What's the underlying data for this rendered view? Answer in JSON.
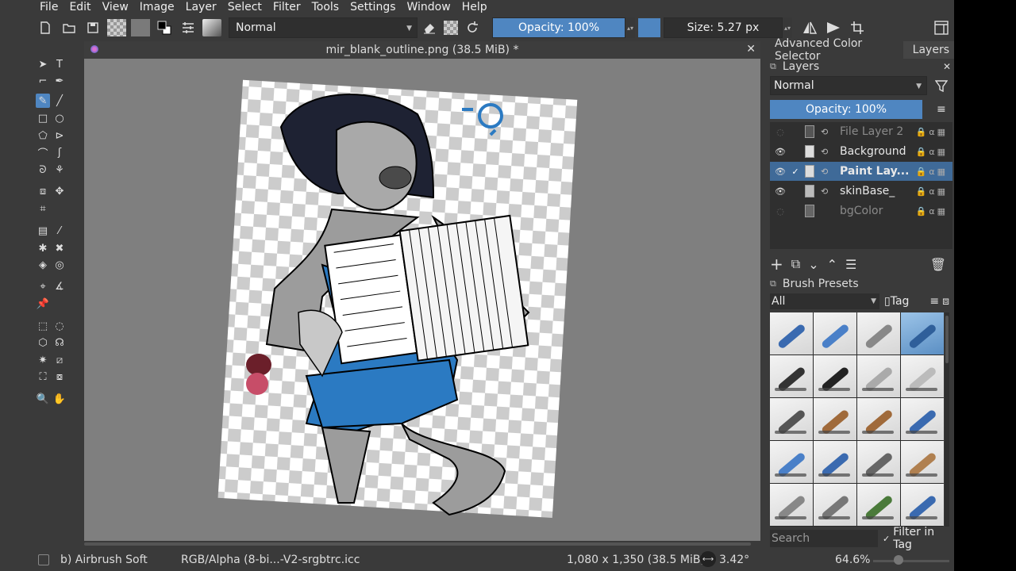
{
  "menu": [
    "File",
    "Edit",
    "View",
    "Image",
    "Layer",
    "Select",
    "Filter",
    "Tools",
    "Settings",
    "Window",
    "Help"
  ],
  "toolbar": {
    "blend_mode": "Normal",
    "opacity_label": "Opacity: 100%",
    "size_label": "Size: 5.27 px",
    "brush_color": "#4f86c1"
  },
  "document": {
    "title": "mir_blank_outline.png (38.5 MiB) *"
  },
  "docker": {
    "tabs": [
      "Advanced Color Selector",
      "Layers"
    ],
    "layers_title": "Layers",
    "blend_mode": "Normal",
    "opacity_label": "Opacity:  100%",
    "layers": [
      {
        "name": "File Layer 2",
        "visible": false,
        "selected": false
      },
      {
        "name": "Background",
        "visible": true,
        "selected": false
      },
      {
        "name": "Paint Lay...",
        "visible": true,
        "selected": true
      },
      {
        "name": "skinBase_",
        "visible": true,
        "selected": false
      },
      {
        "name": "bgColor",
        "visible": false,
        "selected": false
      }
    ],
    "brush_presets_title": "Brush Presets",
    "brush_filter": "All",
    "tag_label": "Tag",
    "search_placeholder": "Search",
    "filter_in_tag": "Filter in Tag"
  },
  "status": {
    "brush_name": "b) Airbrush Soft",
    "color_profile": "RGB/Alpha (8-bi...-V2-srgbtrc.icc",
    "image_size": "1,080 x 1,350 (38.5 MiB)",
    "rotation": "3.42°",
    "zoom": "64.6%"
  }
}
